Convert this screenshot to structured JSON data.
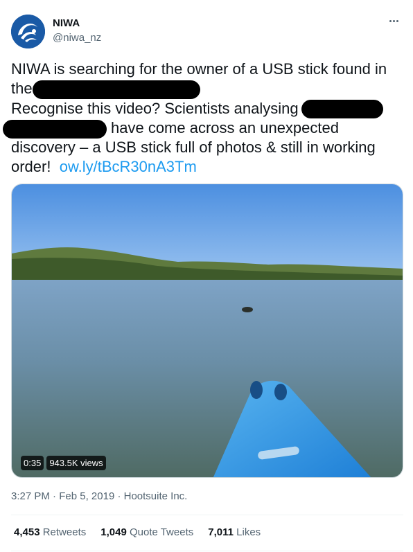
{
  "user": {
    "name": "NIWA",
    "handle": "@niwa_nz"
  },
  "tweet": {
    "line1": "NIWA is searching for the owner of a USB stick found in",
    "line2_prefix": "the",
    "line3": "Recognise this video? Scientists analysing",
    "line4_suffix": "have come across an unexpected",
    "line5": "discovery – a USB stick full of photos & still in working",
    "line6_prefix": "order!",
    "link": "ow.ly/tBcR30nA3Tm"
  },
  "video": {
    "duration": "0:35",
    "views": "943.5K views"
  },
  "meta": {
    "time": "3:27 PM",
    "date": "Feb 5, 2019",
    "source": "Hootsuite Inc.",
    "separator": " · "
  },
  "stats": [
    {
      "count": "4,453",
      "label": "Retweets"
    },
    {
      "count": "1,049",
      "label": "Quote Tweets"
    },
    {
      "count": "7,011",
      "label": "Likes"
    }
  ],
  "colors": {
    "link": "#1d9bf0",
    "secondary_text": "#536471",
    "avatar_bg": "#1a5aa6"
  },
  "icons": {
    "more": "more-dots-icon",
    "avatar": "niwa-logo"
  }
}
